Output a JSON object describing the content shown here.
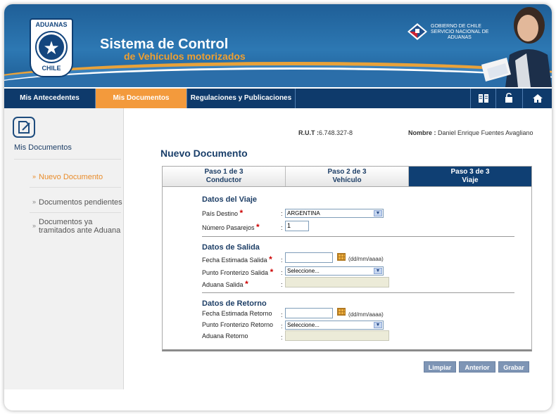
{
  "header": {
    "logo_top": "ADUANAS",
    "logo_bottom": "CHILE",
    "title": "Sistema de Control",
    "subtitle": "de Vehículos motorizados",
    "gov_lines": [
      "GOBIERNO DE CHILE",
      "SERVICIO NACIONAL DE",
      "ADUANAS"
    ]
  },
  "nav": {
    "items": [
      {
        "label": "Mis Antecedentes"
      },
      {
        "label": "Mis Documentos",
        "active": true
      },
      {
        "label": "Regulaciones y Publicaciones"
      }
    ],
    "icons": [
      "book-icon",
      "lock-icon",
      "home-icon"
    ]
  },
  "sidebar": {
    "title": "Mis Documentos",
    "links": [
      {
        "label": "Nuevo Documento",
        "active": true
      },
      {
        "label": "Documentos pendientes"
      },
      {
        "label_line1": "Documentos ya",
        "label_line2": "tramitados ante Aduana"
      }
    ]
  },
  "user": {
    "rut_label": "R.U.T :",
    "rut_value": "6.748.327-8",
    "name_label": "Nombre :",
    "name_value": "Daniel Enrique Fuentes Avagliano"
  },
  "main": {
    "title": "Nuevo Documento",
    "steps": [
      {
        "line1": "Paso 1 de 3",
        "line2": "Conductor"
      },
      {
        "line1": "Paso 2 de 3",
        "line2": "Vehículo"
      },
      {
        "line1": "Paso 3 de 3",
        "line2": "Viaje",
        "active": true
      }
    ]
  },
  "form": {
    "viaje": {
      "heading": "Datos del Viaje",
      "pais_label": "País Destino",
      "pais_value": "ARGENTINA",
      "pasajeros_label": "Número Pasarejos",
      "pasajeros_value": "1"
    },
    "salida": {
      "heading": "Datos de Salida",
      "fecha_label": "Fecha Estimada Salida",
      "fecha_value": "",
      "date_hint": "(dd/mm/aaaa)",
      "punto_label": "Punto Fronterizo Salida",
      "punto_value": "Seleccione...",
      "aduana_label": "Aduana Salida",
      "aduana_value": ""
    },
    "retorno": {
      "heading": "Datos de Retorno",
      "fecha_label": "Fecha Estimada Retorno",
      "fecha_value": "",
      "date_hint": "(dd/mm/aaaa)",
      "punto_label": "Punto Fronterizo Retorno",
      "punto_value": "Seleccione...",
      "aduana_label": "Aduana Retorno",
      "aduana_value": ""
    },
    "required_mark": "*",
    "colon": ":"
  },
  "buttons": {
    "limpiar": "Limpiar",
    "anterior": "Anterior",
    "grabar": "Grabar"
  },
  "colors": {
    "nav_bg": "#0e3a6b",
    "nav_active": "#f39a3c",
    "button": "#7e95b5"
  }
}
